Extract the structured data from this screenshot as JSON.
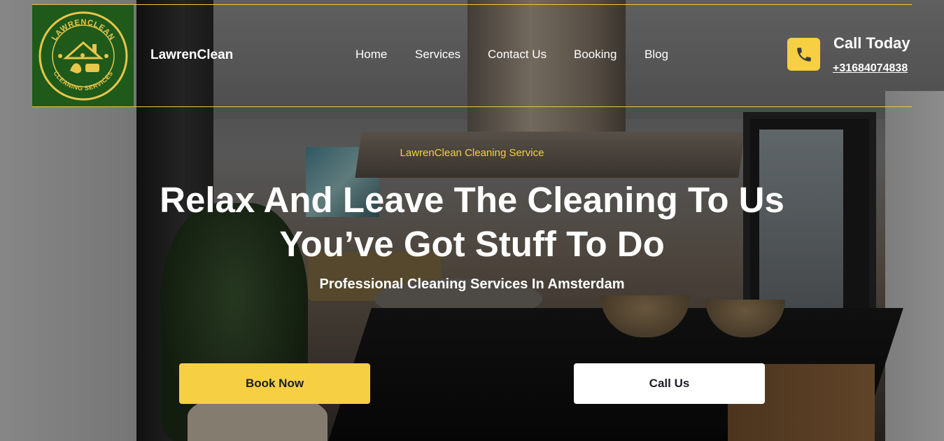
{
  "brand": {
    "logo_text_top": "LAWRENCLEAN",
    "logo_text_bottom": "CLEANING SERVICES",
    "name": "LawrenClean"
  },
  "nav": {
    "items": [
      "Home",
      "Services",
      "Contact Us",
      "Booking",
      "Blog"
    ]
  },
  "contact": {
    "call_today": "Call Today",
    "phone": "+31684074838",
    "icon": "phone-icon"
  },
  "hero": {
    "kicker": "LawrenClean Cleaning Service",
    "headline_line1": "Relax And Leave The Cleaning To Us",
    "headline_line2": "You’ve Got Stuff To Do",
    "subheadline": "Professional Cleaning Services In Amsterdam",
    "primary_button": "Book Now",
    "secondary_button": "Call Us"
  },
  "colors": {
    "accent": "#f6cf43",
    "logo_bg": "#1f5a1a",
    "button_text": "#1c1c2a"
  }
}
